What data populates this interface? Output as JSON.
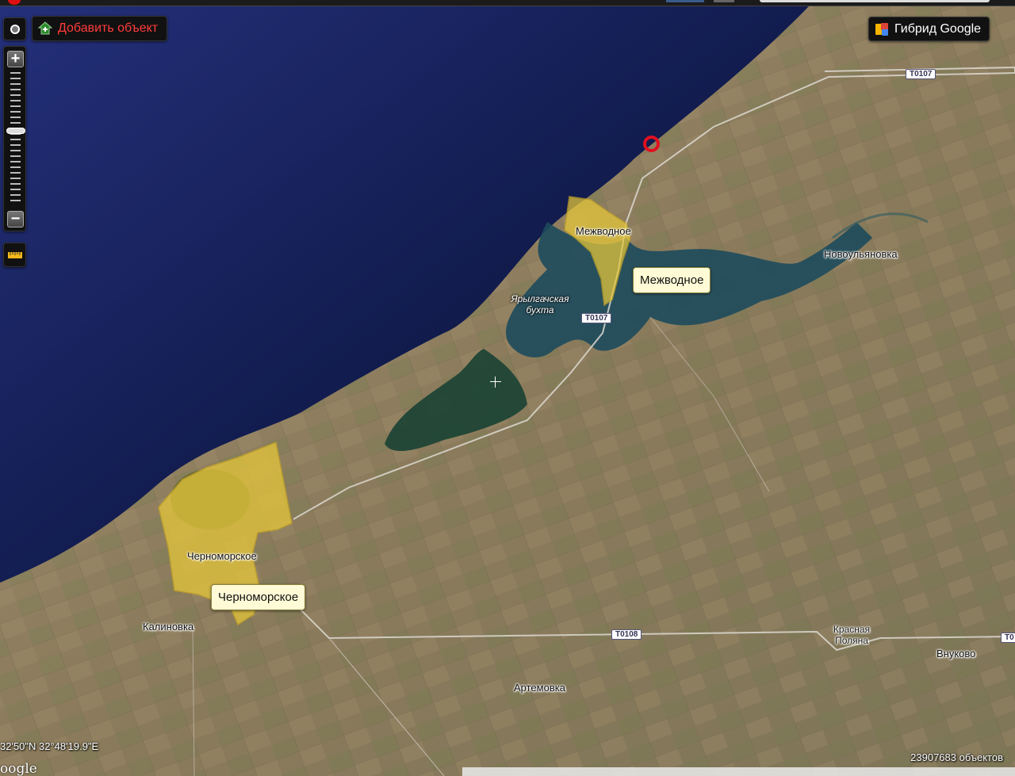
{
  "toolbar": {
    "add_object_label": "Добавить объект",
    "map_type_label": "Гибрид Google"
  },
  "icons": {
    "location": "location-dot-icon",
    "add": "add-object-icon",
    "map_type": "map-layers-icon",
    "zoom_in": "plus-icon",
    "zoom_out": "minus-icon",
    "ruler": "ruler-icon"
  },
  "colors": {
    "accent_red": "#ff3b3b",
    "area_fill": "#e8c93a",
    "callout_bg": "#fffbd6"
  },
  "places": {
    "mezhvodnoe": "Межводное",
    "novoulyanovka": "Новоульяновка",
    "bay": "Ярылгачская бухта",
    "chernomorskoe": "Черноморское",
    "kalinovka": "Калиновка",
    "artemovka": "Артемовка",
    "krasnaya_polyana": "Красная Поляна",
    "vnukovo": "Внуково"
  },
  "callouts": {
    "mezhvodnoe": "Межводное",
    "chernomorskoe": "Черноморское"
  },
  "roads": {
    "t0107_a": "T0107",
    "t0107_b": "T0107",
    "t0108": "T0108",
    "t0108_edge": "T0"
  },
  "status": {
    "coordinates": "32'50\"N 32°48'19.9\"E",
    "objects_count": "23907683 объектов",
    "google": "oogle"
  }
}
